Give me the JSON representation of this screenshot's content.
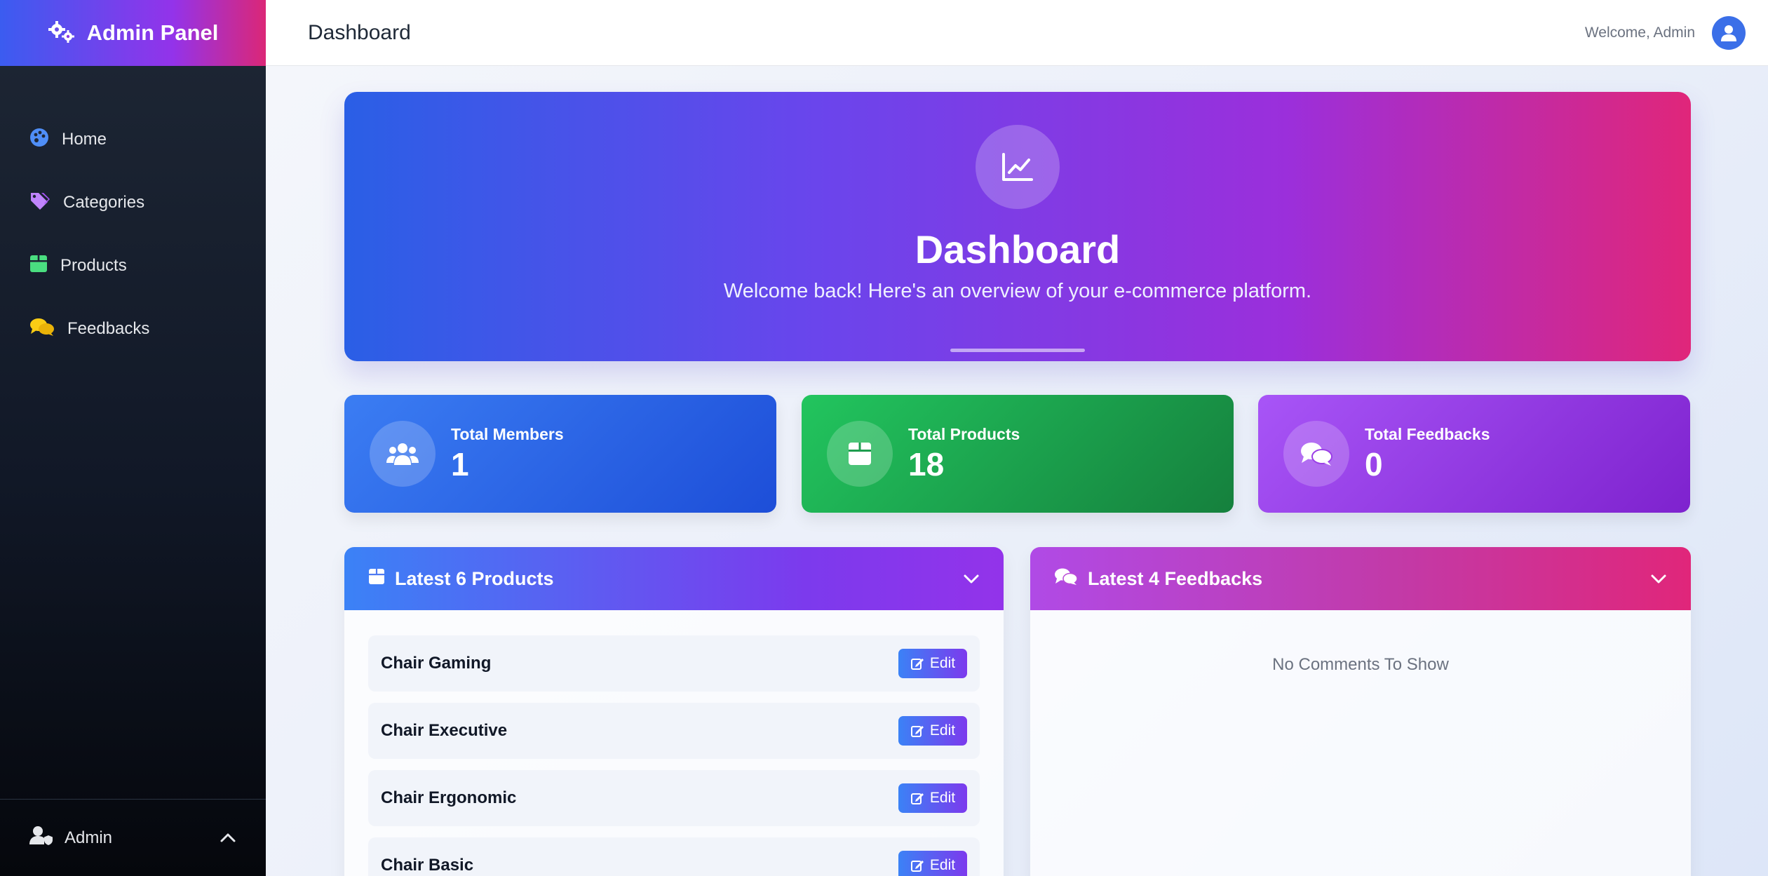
{
  "brand": {
    "title": "Admin Panel",
    "icon": "gears-icon"
  },
  "sidebar": {
    "items": [
      {
        "label": "Home",
        "icon": "palette-icon",
        "color": "#4f8ef7"
      },
      {
        "label": "Categories",
        "icon": "tags-icon",
        "color": "#c084fc"
      },
      {
        "label": "Products",
        "icon": "box-icon",
        "color": "#4ade80"
      },
      {
        "label": "Feedbacks",
        "icon": "comments-icon",
        "color": "#facc15"
      }
    ],
    "footer": {
      "label": "Admin",
      "icon": "user-shield-icon"
    }
  },
  "topbar": {
    "title": "Dashboard",
    "welcome": "Welcome, Admin"
  },
  "hero": {
    "title": "Dashboard",
    "subtitle": "Welcome back! Here's an overview of your e-commerce platform."
  },
  "stats": [
    {
      "label": "Total Members",
      "value": "1",
      "icon": "users-icon"
    },
    {
      "label": "Total Products",
      "value": "18",
      "icon": "box-icon"
    },
    {
      "label": "Total Feedbacks",
      "value": "0",
      "icon": "comments-icon"
    }
  ],
  "products_panel": {
    "title": "Latest 6 Products",
    "edit_label": "Edit",
    "items": [
      "Chair Gaming",
      "Chair Executive",
      "Chair Ergonomic",
      "Chair Basic"
    ]
  },
  "feedbacks_panel": {
    "title": "Latest 4 Feedbacks",
    "empty": "No Comments To Show"
  }
}
